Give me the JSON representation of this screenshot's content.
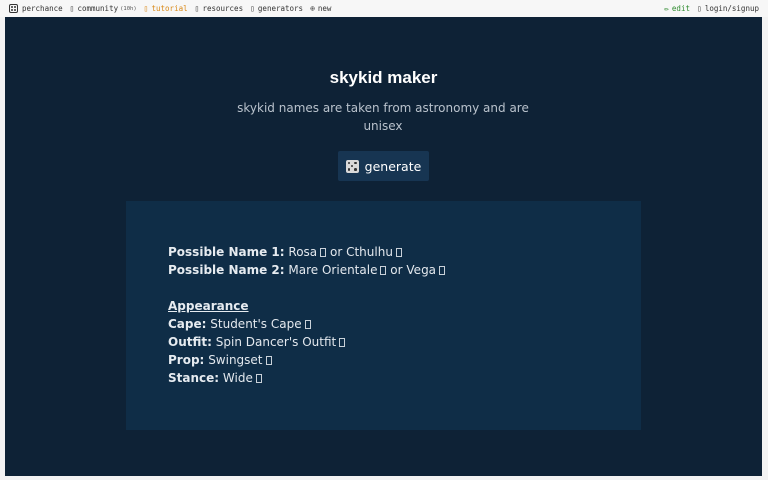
{
  "topbar": {
    "left": [
      {
        "label": "perchance",
        "icon": "dice-icon"
      },
      {
        "label": "community",
        "count": "(10h)",
        "icon": "box-icon"
      },
      {
        "label": "tutorial",
        "icon": "box-icon"
      },
      {
        "label": "resources",
        "icon": "box-icon"
      },
      {
        "label": "generators",
        "icon": "box-icon"
      },
      {
        "label": "new",
        "icon": "plus-circle-icon"
      }
    ],
    "right": [
      {
        "label": "edit",
        "icon": "pencil-icon"
      },
      {
        "label": "login/signup",
        "icon": "box-icon"
      }
    ],
    "colors": {
      "tutorial": "#d98a1a",
      "edit": "#2e8b2e"
    }
  },
  "page": {
    "title": "skykid maker",
    "subtitle": "skykid names are taken from astronomy and are unisex",
    "generate_label": "generate",
    "background": "#0e2236"
  },
  "result": {
    "names": [
      {
        "label": "Possible Name 1:",
        "a": "Rosa",
        "sep": "or",
        "b": "Cthulhu"
      },
      {
        "label": "Possible Name 2:",
        "a": "Mare Orientale",
        "sep": "or",
        "b": "Vega"
      }
    ],
    "appearance_heading": "Appearance",
    "appearance": [
      {
        "label": "Cape:",
        "value": "Student's Cape"
      },
      {
        "label": "Outfit:",
        "value": "Spin Dancer's Outfit"
      },
      {
        "label": "Prop:",
        "value": "Swingset"
      },
      {
        "label": "Stance:",
        "value": "Wide"
      }
    ]
  }
}
